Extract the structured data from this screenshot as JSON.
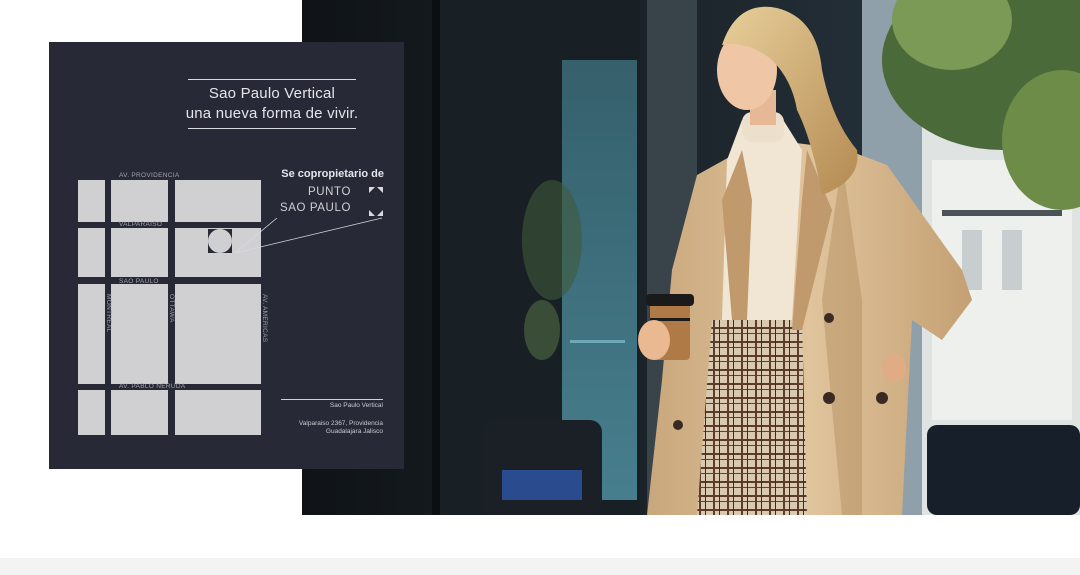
{
  "card": {
    "tagline_line1": "Sao Paulo Vertical",
    "tagline_line2": "una nueva forma de vivir.",
    "streets": {
      "providencia": "AV. PROVIDENCIA",
      "valparaiso": "VALPARAISO",
      "sao_paulo": "SAO PAULO",
      "pablo_neruda": "AV. PABLO NERUDA",
      "montreal": "MONTREAL",
      "ottawa": "OTTAWA",
      "americas": "AV. AMERICAS"
    },
    "copropietario_title": "Se copropietario de",
    "logo_line1": "PUNTO",
    "logo_line2": "SAO PAULO",
    "footer_name": "Sao Paulo Vertical",
    "footer_addr_line1": "Valparaiso 2367, Providencia",
    "footer_addr_line2": "Guadalajara Jalisco"
  },
  "colors": {
    "card_bg": "#272a36",
    "map_block": "#d0d0d3",
    "text_light": "#e4e5ea",
    "coat": "#d2b48c",
    "page_bg": "#ffffff"
  }
}
